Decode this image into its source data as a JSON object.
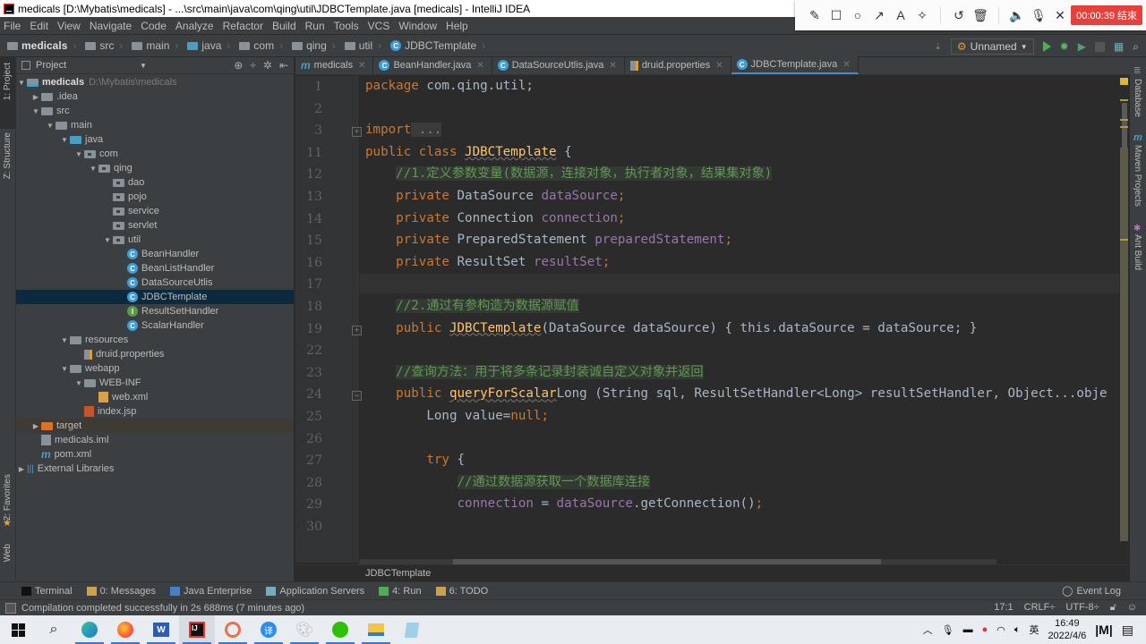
{
  "window": {
    "title": "medicals [D:\\Mybatis\\medicals] - ...\\src\\main\\java\\com\\qing\\util\\JDBCTemplate.java [medicals] - IntelliJ IDEA"
  },
  "recorder": {
    "tools": [
      "pencil-icon",
      "rectangle-icon",
      "circle-icon",
      "arrow-icon",
      "text-icon",
      "magic-wand-icon",
      "undo-icon",
      "trash-icon",
      "speaker-icon",
      "microphone-icon",
      "close-icon"
    ],
    "glyphs": [
      "✎",
      "☐",
      "○",
      "↗",
      "A",
      "✧",
      "↺",
      "🗑",
      "🔈",
      "🎙",
      "✕"
    ],
    "timer": "00:00:39 结束"
  },
  "menu": [
    "File",
    "Edit",
    "View",
    "Navigate",
    "Code",
    "Analyze",
    "Refactor",
    "Build",
    "Run",
    "Tools",
    "VCS",
    "Window",
    "Help"
  ],
  "breadcrumb": [
    "medicals",
    "src",
    "main",
    "java",
    "com",
    "qing",
    "util",
    "JDBCTemplate"
  ],
  "run_config": "Unnamed",
  "left_tools": [
    "1: Project",
    "Z: Structure",
    "2: Favorites",
    "Web"
  ],
  "right_tools": [
    "Database",
    "Maven Projects",
    "Ant Build"
  ],
  "project": {
    "header": "Project",
    "root": {
      "name": "medicals",
      "path": "D:\\Mybatis\\medicals"
    },
    "items": [
      {
        "label": ".idea",
        "depth": 1,
        "arrow": "▶",
        "type": "folder"
      },
      {
        "label": "src",
        "depth": 1,
        "arrow": "▼",
        "type": "folder"
      },
      {
        "label": "main",
        "depth": 2,
        "arrow": "▼",
        "type": "folder"
      },
      {
        "label": "java",
        "depth": 3,
        "arrow": "▼",
        "type": "folder-blue"
      },
      {
        "label": "com",
        "depth": 4,
        "arrow": "▼",
        "type": "package"
      },
      {
        "label": "qing",
        "depth": 5,
        "arrow": "▼",
        "type": "package"
      },
      {
        "label": "dao",
        "depth": 6,
        "arrow": "",
        "type": "package"
      },
      {
        "label": "pojo",
        "depth": 6,
        "arrow": "",
        "type": "package"
      },
      {
        "label": "service",
        "depth": 6,
        "arrow": "",
        "type": "package"
      },
      {
        "label": "servlet",
        "depth": 6,
        "arrow": "",
        "type": "package"
      },
      {
        "label": "util",
        "depth": 6,
        "arrow": "▼",
        "type": "package"
      },
      {
        "label": "BeanHandler",
        "depth": 7,
        "arrow": "",
        "type": "class"
      },
      {
        "label": "BeanListHandler",
        "depth": 7,
        "arrow": "",
        "type": "class"
      },
      {
        "label": "DataSourceUtlis",
        "depth": 7,
        "arrow": "",
        "type": "class"
      },
      {
        "label": "JDBCTemplate",
        "depth": 7,
        "arrow": "",
        "type": "class",
        "selected": true
      },
      {
        "label": "ResultSetHandler",
        "depth": 7,
        "arrow": "",
        "type": "interface"
      },
      {
        "label": "ScalarHandler",
        "depth": 7,
        "arrow": "",
        "type": "class"
      },
      {
        "label": "resources",
        "depth": 3,
        "arrow": "▼",
        "type": "folder"
      },
      {
        "label": "druid.properties",
        "depth": 4,
        "arrow": "",
        "type": "properties"
      },
      {
        "label": "webapp",
        "depth": 3,
        "arrow": "▼",
        "type": "folder"
      },
      {
        "label": "WEB-INF",
        "depth": 4,
        "arrow": "▼",
        "type": "folder"
      },
      {
        "label": "web.xml",
        "depth": 5,
        "arrow": "",
        "type": "xml"
      },
      {
        "label": "index.jsp",
        "depth": 4,
        "arrow": "",
        "type": "jsp"
      },
      {
        "label": "target",
        "depth": 1,
        "arrow": "▶",
        "type": "folder-orange",
        "excluded": true
      },
      {
        "label": "medicals.iml",
        "depth": 1,
        "arrow": "",
        "type": "file"
      },
      {
        "label": "pom.xml",
        "depth": 1,
        "arrow": "",
        "type": "maven"
      },
      {
        "label": "External Libraries",
        "depth": 0,
        "arrow": "▶",
        "type": "library"
      }
    ]
  },
  "tabs": [
    {
      "label": "medicals",
      "icon": "maven"
    },
    {
      "label": "BeanHandler.java",
      "icon": "class"
    },
    {
      "label": "DataSourceUtlis.java",
      "icon": "class"
    },
    {
      "label": "druid.properties",
      "icon": "properties"
    },
    {
      "label": "JDBCTemplate.java",
      "icon": "class",
      "active": true
    }
  ],
  "code": {
    "line_numbers": [
      "1",
      "2",
      "3",
      "11",
      "12",
      "13",
      "14",
      "15",
      "16",
      "17",
      "18",
      "19",
      "22",
      "23",
      "24",
      "25",
      "26",
      "27",
      "28",
      "29",
      "30"
    ],
    "lines": [
      {
        "k": "package",
        "r": " com.qing.util;"
      },
      {},
      {
        "k": "import",
        "dim": " ..."
      },
      {
        "k": "public class ",
        "u": "JDBCTemplate",
        "r": " {"
      },
      {
        "i": "    ",
        "c": "//1.定义参数变量(数据源，连接对象，执行者对象，结果集对象)"
      },
      {
        "i": "    ",
        "k": "private ",
        "r": "DataSource ",
        "f": "dataSource",
        "e": ";"
      },
      {
        "i": "    ",
        "k": "private ",
        "r": "Connection ",
        "f": "connection",
        "e": ";"
      },
      {
        "i": "    ",
        "k": "private ",
        "r": "PreparedStatement ",
        "f": "preparedStatement",
        "e": ";"
      },
      {
        "i": "    ",
        "k": "private ",
        "r": "ResultSet ",
        "f": "resultSet",
        "e": ";"
      },
      {},
      {
        "i": "    ",
        "c": "//2.通过有参构造为数据源赋值"
      },
      {
        "i": "    ",
        "k": "public ",
        "u": "JDBCTemplate",
        "r": "(DataSource dataSource) { this.dataSource = dataSource; }"
      },
      {},
      {
        "i": "    ",
        "c": "//查询方法：用于将多条记录封装诚自定义对象并返回"
      },
      {
        "i": "    ",
        "k": "public ",
        "r": "Long ",
        "u": "queryForScalar",
        "r2": "(String sql, ResultSetHandler<Long> resultSetHandler, Object...obje"
      },
      {
        "i": "        ",
        "r": "Long value=",
        "k2": "null",
        "e": ";"
      },
      {},
      {
        "i": "        ",
        "k": "try ",
        "r": "{"
      },
      {
        "i": "            ",
        "c": "//通过数据源获取一个数据库连接"
      },
      {
        "i": "            ",
        "f": "connection",
        "r": " = ",
        "f2": "dataSource",
        "r2": ".getConnection()",
        "e": ";"
      },
      {}
    ]
  },
  "editor_breadcrumb": "JDBCTemplate",
  "bottom_tools": [
    "Terminal",
    "0: Messages",
    "Java Enterprise",
    "Application Servers",
    "4: Run",
    "6: TODO"
  ],
  "event_log": "Event Log",
  "status": {
    "message": "Compilation completed successfully in 2s 688ms (7 minutes ago)",
    "position": "17:1",
    "line_sep": "CRLF÷",
    "encoding": "UTF-8÷"
  },
  "taskbar": {
    "apps": [
      "start",
      "search",
      "edge",
      "firefox",
      "word",
      "intellij",
      "app-circle",
      "translate",
      "paint",
      "wechat",
      "explorer",
      "notepad"
    ],
    "time": "16:49",
    "date": "2022/4/6",
    "ime": "英"
  }
}
